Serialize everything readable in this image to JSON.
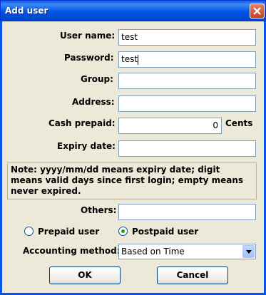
{
  "window": {
    "title": "Add user"
  },
  "form": {
    "username_label": "User name:",
    "username_value": "test",
    "password_label": "Password:",
    "password_value": "test",
    "group_label": "Group:",
    "group_value": "",
    "address_label": "Address:",
    "address_value": "",
    "cash_label": "Cash prepaid:",
    "cash_value": "0",
    "cash_unit": "Cents",
    "expiry_label": "Expiry date:",
    "expiry_value": "",
    "note": "Note: yyyy/mm/dd means expiry date; digit means valid days since first login; empty means never expired.",
    "others_label": "Others:",
    "others_value": "",
    "prepaid_label": "Prepaid user",
    "postpaid_label": "Postpaid user",
    "selected_user_type": "Postpaid user",
    "accounting_label": "Accounting method:",
    "accounting_value": "Based on Time"
  },
  "buttons": {
    "ok": "OK",
    "cancel": "Cancel"
  },
  "colors": {
    "titlebar": "#0055e5",
    "dialog_bg": "#ece9d8",
    "close": "#c7401d",
    "radio_selected": "#21a121"
  }
}
